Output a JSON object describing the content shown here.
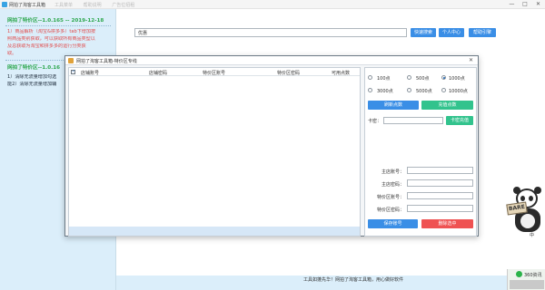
{
  "app": {
    "title": "网拍了淘客工具箱",
    "faded_tabs": [
      "工具菜单",
      "帮助说明",
      "广告位招租"
    ],
    "window_controls": {
      "minimize": "—",
      "maximize": "□",
      "close": "✕"
    }
  },
  "sidebar": {
    "version_heading": "网拍了特价区--1.0.165 -- 2019-12-18",
    "update_notes": [
      "1）商品解析（淘宝&拼多多）tab下增加按",
      "照商品类别获取，可以获取所有商品类型以",
      "及总获取为淘宝和拼多多的运行分类获",
      "取。"
    ],
    "version_heading_2": "网拍了特价区--1.0.16",
    "notes_2": [
      "1）清除无流量增加勾选",
      "能2）清除无流量增加辅"
    ]
  },
  "search": {
    "value": "优惠"
  },
  "toolbar": {
    "quick_search": "快速搜索",
    "user_center": "个人中心",
    "help": "帮助引擎"
  },
  "status_bar": {
    "text": "工具如蓬先华！网拍了淘客工具箱，用心做好软件"
  },
  "widget": {
    "label": "360资讯"
  },
  "mascot": {
    "sign": "BARE",
    "caption": "中"
  },
  "dialog": {
    "title": "网拍了淘客工具箱-特价区专线",
    "close": "✕",
    "table": {
      "columns": [
        "店铺账号",
        "店铺密码",
        "特价区账号",
        "特价区密码",
        "可用点数"
      ],
      "rows": []
    },
    "points": {
      "options": [
        "100点",
        "500点",
        "1000点",
        "3000点",
        "5000点",
        "10000点"
      ],
      "selected": "1000点"
    },
    "refresh_button": "刷新点数",
    "recharge_button": "充值点数",
    "card_label": "卡密：",
    "card_value": "",
    "card_recharge_button": "卡密充值",
    "fields": {
      "main_account_label": "主店账号：",
      "main_password_label": "主店密码：",
      "special_account_label": "特价区账号：",
      "special_password_label": "特价区密码："
    },
    "save_button": "保存账号",
    "delete_button": "删除选中"
  }
}
